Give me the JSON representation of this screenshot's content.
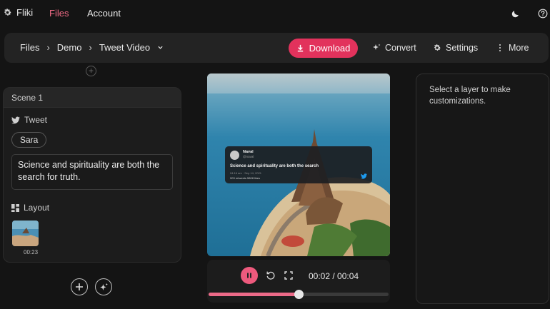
{
  "nav": {
    "brand": "Fliki",
    "files": "Files",
    "account": "Account"
  },
  "toolbar": {
    "breadcrumbs": [
      "Files",
      "Demo",
      "Tweet Video"
    ],
    "download": "Download",
    "convert": "Convert",
    "settings": "Settings",
    "more": "More"
  },
  "scene": {
    "title": "Scene 1",
    "tweet_label": "Tweet",
    "speaker": "Sara",
    "text": "Science and spirituality are both the search for truth.",
    "layout_label": "Layout",
    "layout_duration": "00:23"
  },
  "preview": {
    "tweet": {
      "name": "Naval",
      "handle": "@naval",
      "text": "Science and spirituality are both the search",
      "meta": "04:16 am · Sep 14, 2021",
      "stats": "903 retweets  5808 likes"
    }
  },
  "player": {
    "time": "00:02 / 00:04",
    "progress": 0.5
  },
  "properties": {
    "message": "Select a layer to make customizations."
  },
  "colors": {
    "accent": "#e2325c",
    "active_nav": "#f06b86",
    "progress": "#ec6a88"
  }
}
